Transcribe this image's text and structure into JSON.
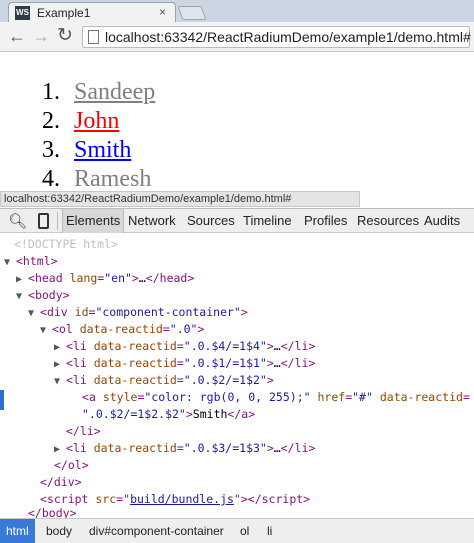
{
  "browser": {
    "tab_title": "Example1",
    "favicon_text": "WS",
    "url": "localhost:63342/ReactRadiumDemo/example1/demo.html#"
  },
  "page": {
    "people": [
      {
        "num": "1.",
        "name": "Sandeep",
        "color": "#808080"
      },
      {
        "num": "2.",
        "name": "John",
        "color": "#ff0000"
      },
      {
        "num": "3.",
        "name": "Smith",
        "color": "#0000ff"
      },
      {
        "num": "4.",
        "name": "Ramesh",
        "color": "#808080"
      }
    ]
  },
  "status_bar": {
    "text": "localhost:63342/ReactRadiumDemo/example1/demo.html#"
  },
  "devtools": {
    "tabs": [
      "Elements",
      "Network",
      "Sources",
      "Timeline",
      "Profiles",
      "Resources",
      "Audits"
    ],
    "selected_tab": "Elements",
    "dom": {
      "doctype": "<!DOCTYPE html>",
      "html_open": "<html>",
      "head": "<head lang=\"en\">…</head>",
      "head_tag": "head",
      "head_attr": "lang",
      "head_val": "\"en\"",
      "body": "body",
      "div": "div",
      "div_attr": "id",
      "div_val": "\"component-container\"",
      "ol": "ol",
      "ol_attr": "data-reactid",
      "ol_val": "\".0\"",
      "li_tag": "li",
      "li_attr": "data-reactid",
      "li1_val": "\".0.$4/=1$4\"",
      "li2_val": "\".0.$1/=1$1\"",
      "li3_val": "\".0.$2/=1$2\"",
      "li4_val": "\".0.$3/=1$3\"",
      "ellipsis": "…",
      "a_tag": "a",
      "a_style_attr": "style",
      "a_style_val": "\"color: rgb(0, 0, 255);\"",
      "a_href_attr": "href",
      "a_href_val": "\"#\"",
      "a_reactid_attr": "data-reactid",
      "a_reactid_val": "\".0.$2/=1$2.$2\"",
      "a_text": "Smith",
      "script_tag": "script",
      "script_attr": "src",
      "script_val": "build/bundle.js"
    },
    "breadcrumbs": [
      "html",
      "body",
      "div#component-container",
      "ol",
      "li"
    ]
  }
}
